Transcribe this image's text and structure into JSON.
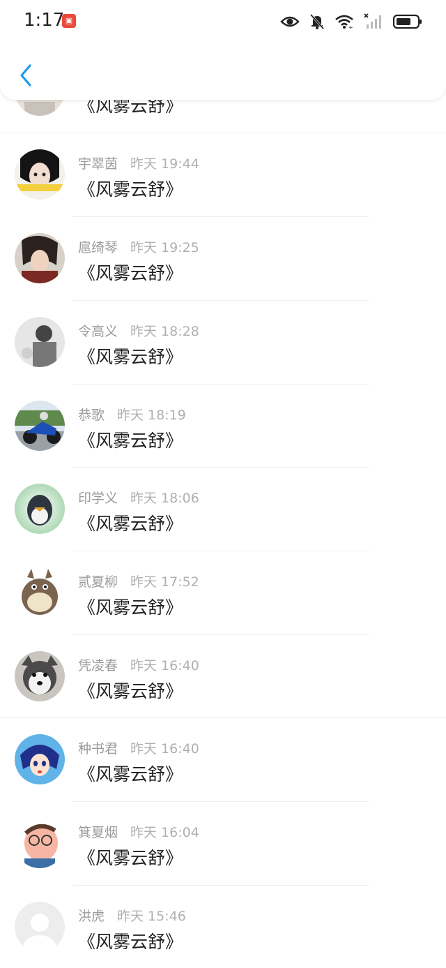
{
  "status_bar": {
    "time": "1:17",
    "app_badge_icon": "shopping-app-icon",
    "icons": [
      "eye-icon",
      "bell-muted-icon",
      "wifi-icon",
      "signal-off-icon",
      "battery-icon"
    ]
  },
  "header": {
    "back_icon": "chevron-left-icon",
    "accent": "#1a9bf0"
  },
  "comments": [
    {
      "name": "",
      "time": "",
      "text": "《风雾云舒》",
      "avatar": "partial-avatar"
    },
    {
      "name": "宇翠茵",
      "time": "昨天 19:44",
      "text": "《风雾云舒》",
      "avatar": "girl-photo-avatar"
    },
    {
      "name": "扈绮琴",
      "time": "昨天 19:25",
      "text": "《风雾云舒》",
      "avatar": "anime-boy-avatar"
    },
    {
      "name": "令高义",
      "time": "昨天 18:28",
      "text": "《风雾云舒》",
      "avatar": "grayscale-photo-avatar"
    },
    {
      "name": "恭歌",
      "time": "昨天 18:19",
      "text": "《风雾云舒》",
      "avatar": "motorcycle-avatar"
    },
    {
      "name": "印学义",
      "time": "昨天 18:06",
      "text": "《风雾云舒》",
      "avatar": "penguin-avatar"
    },
    {
      "name": "贰夏柳",
      "time": "昨天 17:52",
      "text": "《风雾云舒》",
      "avatar": "totoro-avatar"
    },
    {
      "name": "凭凌春",
      "time": "昨天 16:40",
      "text": "《风雾云舒》",
      "avatar": "husky-avatar"
    },
    {
      "name": "种书君",
      "time": "昨天 16:40",
      "text": "《风雾云舒》",
      "avatar": "sailor-girl-avatar"
    },
    {
      "name": "箕夏烟",
      "time": "昨天 16:04",
      "text": "《风雾云舒》",
      "avatar": "cartoon-man-avatar"
    },
    {
      "name": "洪虎",
      "time": "昨天 15:46",
      "text": "《风雾云舒》",
      "avatar": "default-avatar"
    }
  ]
}
